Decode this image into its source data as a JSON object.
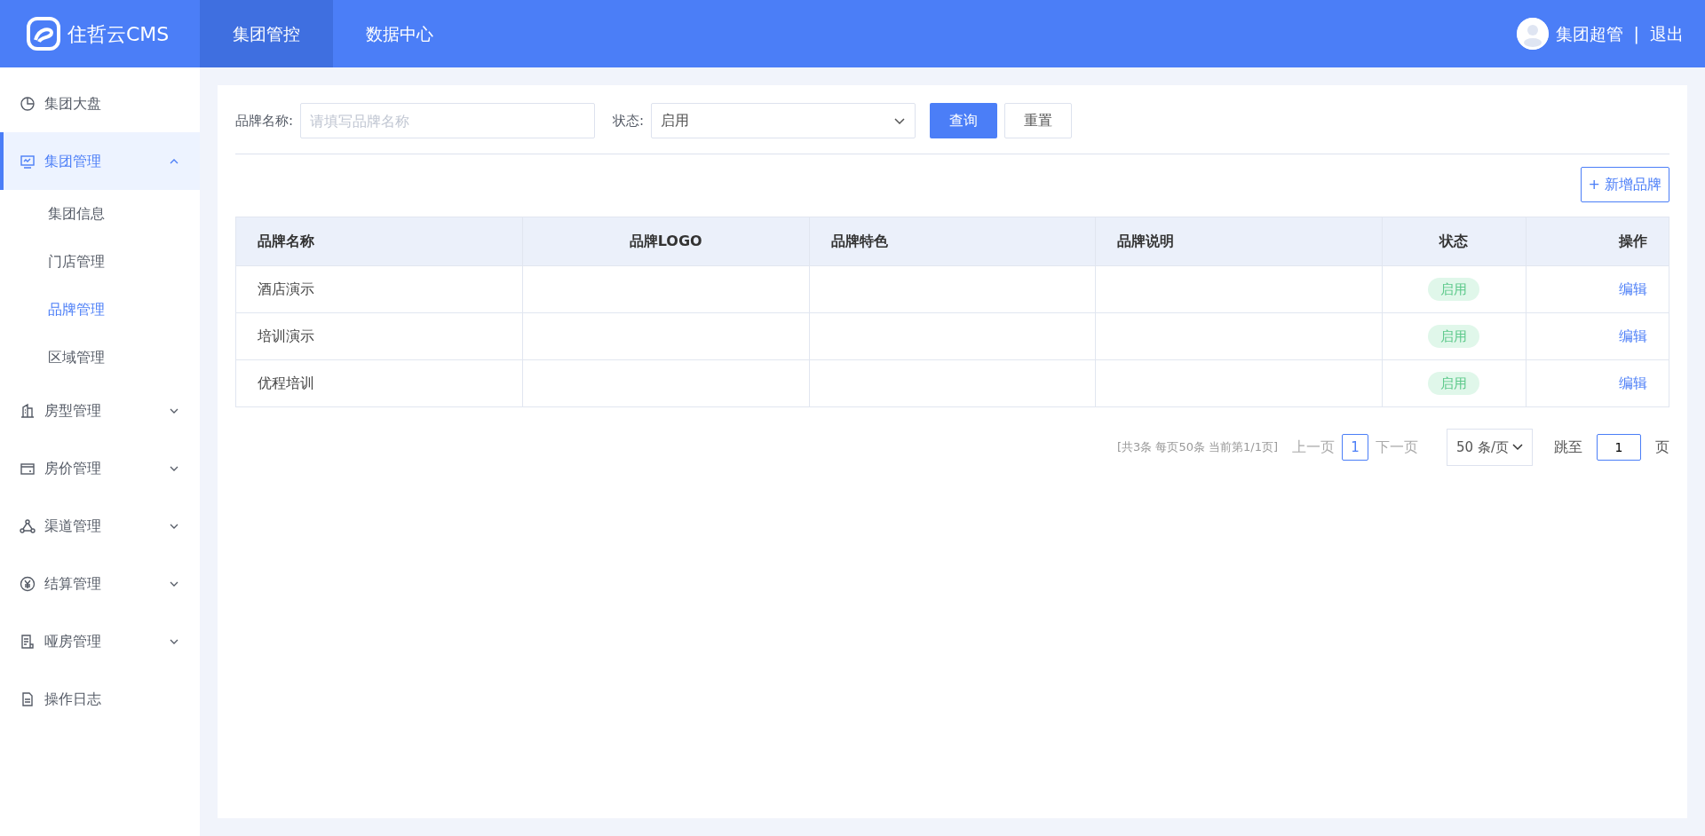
{
  "header": {
    "logo_text": "住哲云CMS",
    "nav": [
      {
        "label": "集团管控",
        "selected": true
      },
      {
        "label": "数据中心",
        "selected": false
      }
    ],
    "user": {
      "name": "集团超管",
      "separator": "|",
      "logout": "退出"
    }
  },
  "sidebar": {
    "items": [
      {
        "kind": "link",
        "label": "集团大盘",
        "selected": false
      },
      {
        "kind": "group",
        "label": "集团管理",
        "selected": true,
        "expanded": true,
        "children": [
          {
            "label": "集团信息",
            "selected": false
          },
          {
            "label": "门店管理",
            "selected": false
          },
          {
            "label": "品牌管理",
            "selected": true
          },
          {
            "label": "区域管理",
            "selected": false
          }
        ]
      },
      {
        "kind": "group",
        "label": "房型管理",
        "selected": false,
        "expanded": false
      },
      {
        "kind": "group",
        "label": "房价管理",
        "selected": false,
        "expanded": false
      },
      {
        "kind": "group",
        "label": "渠道管理",
        "selected": false,
        "expanded": false
      },
      {
        "kind": "group",
        "label": "结算管理",
        "selected": false,
        "expanded": false
      },
      {
        "kind": "group",
        "label": "哑房管理",
        "selected": false,
        "expanded": false
      },
      {
        "kind": "link",
        "label": "操作日志",
        "selected": false
      }
    ]
  },
  "filters": {
    "name_label": "品牌名称:",
    "name_placeholder": "请填写品牌名称",
    "status_label": "状态:",
    "status_value": "启用",
    "search_button": "查询",
    "reset_button": "重置"
  },
  "add_button": {
    "icon_text": "+",
    "label": "新增品牌"
  },
  "table": {
    "columns": [
      "品牌名称",
      "品牌LOGO",
      "品牌特色",
      "品牌说明",
      "状态",
      "操作"
    ],
    "rows": [
      {
        "name": "酒店演示",
        "status": "启用",
        "action": "编辑"
      },
      {
        "name": "培训演示",
        "status": "启用",
        "action": "编辑"
      },
      {
        "name": "优程培训",
        "status": "启用",
        "action": "编辑"
      }
    ]
  },
  "pagination": {
    "summary": "[共3条 每页50条 当前第1/1页]",
    "prev": {
      "label": "上一页",
      "disabled": true
    },
    "pages": [
      {
        "label": "1",
        "selected": true
      }
    ],
    "next": {
      "label": "下一页",
      "disabled": true
    },
    "page_size": "50 条/页",
    "jump_label": "跳至",
    "jump_value": "1",
    "page_unit": "页"
  }
}
